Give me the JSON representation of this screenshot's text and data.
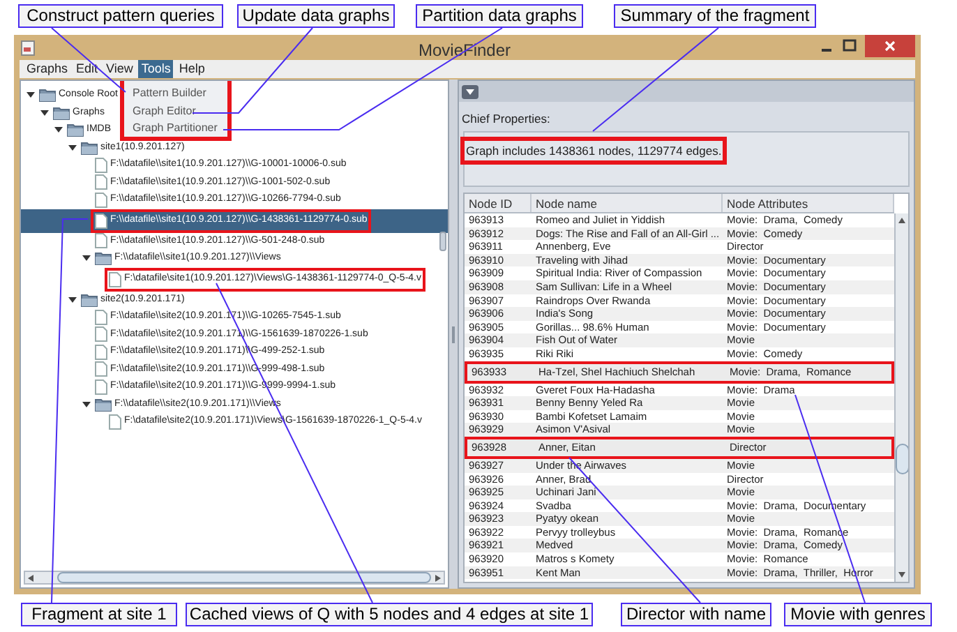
{
  "annotations": {
    "top": [
      "Construct pattern queries",
      "Update data graphs",
      "Partition data graphs",
      "Summary of the fragment"
    ],
    "bottom": [
      "Fragment at site 1",
      "Cached views of Q with 5 nodes and 4 edges at site 1",
      "Director with name",
      "Movie with genres"
    ]
  },
  "window": {
    "title": "MovieFinder"
  },
  "menu_bar": [
    {
      "label": "Graphs",
      "selected": false
    },
    {
      "label": "Edit",
      "selected": false
    },
    {
      "label": "View",
      "selected": false
    },
    {
      "label": "Tools",
      "selected": true
    },
    {
      "label": "Help",
      "selected": false
    }
  ],
  "tools_menu": {
    "highlighted": true,
    "items": [
      "Pattern Builder",
      "Graph Editor",
      "Graph Partitioner"
    ]
  },
  "tree": [
    {
      "label": "Console Root",
      "kind": "folder",
      "expanded": true,
      "selected": false,
      "highlighted": false,
      "children": [
        {
          "label": "Graphs",
          "kind": "folder",
          "expanded": true,
          "selected": false,
          "highlighted": false,
          "children": [
            {
              "label": "IMDB",
              "kind": "folder",
              "expanded": true,
              "selected": false,
              "highlighted": false,
              "children": [
                {
                  "label": "site1(10.9.201.127)",
                  "kind": "folder",
                  "expanded": true,
                  "selected": false,
                  "highlighted": false,
                  "children": [
                    {
                      "label": "F:\\\\datafile\\\\site1(10.9.201.127)\\\\G-10001-10006-0.sub",
                      "kind": "file",
                      "selected": false,
                      "highlighted": false
                    },
                    {
                      "label": "F:\\\\datafile\\\\site1(10.9.201.127)\\\\G-1001-502-0.sub",
                      "kind": "file",
                      "selected": false,
                      "highlighted": false
                    },
                    {
                      "label": "F:\\\\datafile\\\\site1(10.9.201.127)\\\\G-10266-7794-0.sub",
                      "kind": "file",
                      "selected": false,
                      "highlighted": false
                    },
                    {
                      "label": "F:\\\\datafile\\\\site1(10.9.201.127)\\\\G-1438361-1129774-0.sub",
                      "kind": "file",
                      "selected": true,
                      "highlighted": true
                    },
                    {
                      "label": "F:\\\\datafile\\\\site1(10.9.201.127)\\\\G-501-248-0.sub",
                      "kind": "file",
                      "selected": false,
                      "highlighted": false
                    },
                    {
                      "label": "F:\\\\datafile\\\\site1(10.9.201.127)\\\\Views",
                      "kind": "folder",
                      "expanded": true,
                      "selected": false,
                      "highlighted": false,
                      "children": [
                        {
                          "label": "F:\\datafile\\site1(10.9.201.127)\\Views\\G-1438361-1129774-0_Q-5-4.v",
                          "kind": "file",
                          "selected": false,
                          "highlighted": true
                        }
                      ]
                    }
                  ]
                },
                {
                  "label": "site2(10.9.201.171)",
                  "kind": "folder",
                  "expanded": true,
                  "selected": false,
                  "highlighted": false,
                  "children": [
                    {
                      "label": "F:\\\\datafile\\\\site2(10.9.201.171)\\\\G-10265-7545-1.sub",
                      "kind": "file",
                      "selected": false,
                      "highlighted": false
                    },
                    {
                      "label": "F:\\\\datafile\\\\site2(10.9.201.171)\\\\G-1561639-1870226-1.sub",
                      "kind": "file",
                      "selected": false,
                      "highlighted": false
                    },
                    {
                      "label": "F:\\\\datafile\\\\site2(10.9.201.171)\\\\G-499-252-1.sub",
                      "kind": "file",
                      "selected": false,
                      "highlighted": false
                    },
                    {
                      "label": "F:\\\\datafile\\\\site2(10.9.201.171)\\\\G-999-498-1.sub",
                      "kind": "file",
                      "selected": false,
                      "highlighted": false
                    },
                    {
                      "label": "F:\\\\datafile\\\\site2(10.9.201.171)\\\\G-9999-9994-1.sub",
                      "kind": "file",
                      "selected": false,
                      "highlighted": false
                    },
                    {
                      "label": "F:\\\\datafile\\\\site2(10.9.201.171)\\\\Views",
                      "kind": "folder",
                      "expanded": true,
                      "selected": false,
                      "highlighted": false,
                      "children": [
                        {
                          "label": "F:\\datafile\\site2(10.9.201.171)\\Views\\G-1561639-1870226-1_Q-5-4.v",
                          "kind": "file",
                          "selected": false,
                          "highlighted": false
                        }
                      ]
                    }
                  ]
                }
              ]
            }
          ]
        }
      ]
    }
  ],
  "properties": {
    "title": "Chief Properties:",
    "summary": "Graph includes 1438361 nodes, 1129774 edges.",
    "highlighted": true
  },
  "table": {
    "columns": [
      "Node ID",
      "Node name",
      "Node Attributes"
    ],
    "rows": [
      {
        "cells": [
          "963913",
          "Romeo and Juliet in Yiddish",
          "Movie:  Drama,  Comedy"
        ],
        "highlighted": false
      },
      {
        "cells": [
          "963912",
          "Dogs: The Rise and Fall of an All-Girl ...",
          "Movie:  Comedy"
        ],
        "highlighted": false
      },
      {
        "cells": [
          "963911",
          "Annenberg, Eve",
          "Director"
        ],
        "highlighted": false
      },
      {
        "cells": [
          "963910",
          "Traveling with Jihad",
          "Movie:  Documentary"
        ],
        "highlighted": false
      },
      {
        "cells": [
          "963909",
          "Spiritual India: River of Compassion",
          "Movie:  Documentary"
        ],
        "highlighted": false
      },
      {
        "cells": [
          "963908",
          "Sam Sullivan: Life in a Wheel",
          "Movie:  Documentary"
        ],
        "highlighted": false
      },
      {
        "cells": [
          "963907",
          "Raindrops Over Rwanda",
          "Movie:  Documentary"
        ],
        "highlighted": false
      },
      {
        "cells": [
          "963906",
          "India's Song",
          "Movie:  Documentary"
        ],
        "highlighted": false
      },
      {
        "cells": [
          "963905",
          "Gorillas... 98.6% Human",
          "Movie:  Documentary"
        ],
        "highlighted": false
      },
      {
        "cells": [
          "963904",
          "Fish Out of Water",
          "Movie"
        ],
        "highlighted": false
      },
      {
        "cells": [
          "963935",
          "Riki Riki",
          "Movie:  Comedy"
        ],
        "highlighted": false
      },
      {
        "cells": [
          "963933",
          "Ha-Tzel, Shel Hachiuch Shelchah",
          "Movie:  Drama,  Romance"
        ],
        "highlighted": true
      },
      {
        "cells": [
          "963932",
          "Gveret Foux Ha-Hadasha",
          "Movie:  Drama"
        ],
        "highlighted": false
      },
      {
        "cells": [
          "963931",
          "Benny Benny Yeled Ra",
          "Movie"
        ],
        "highlighted": false
      },
      {
        "cells": [
          "963930",
          "Bambi Kofetset Lamaim",
          "Movie"
        ],
        "highlighted": false
      },
      {
        "cells": [
          "963929",
          "Asimon V'Asival",
          "Movie"
        ],
        "highlighted": false
      },
      {
        "cells": [
          "963928",
          "Anner, Eitan",
          "Director"
        ],
        "highlighted": true
      },
      {
        "cells": [
          "963927",
          "Under the Airwaves",
          "Movie"
        ],
        "highlighted": false
      },
      {
        "cells": [
          "963926",
          "Anner, Brad",
          "Director"
        ],
        "highlighted": false
      },
      {
        "cells": [
          "963925",
          "Uchinari Jani",
          "Movie"
        ],
        "highlighted": false
      },
      {
        "cells": [
          "963924",
          "Svadba",
          "Movie:  Drama,  Documentary"
        ],
        "highlighted": false
      },
      {
        "cells": [
          "963923",
          "Pyatyy okean",
          "Movie"
        ],
        "highlighted": false
      },
      {
        "cells": [
          "963922",
          "Pervyy trolleybus",
          "Movie:  Drama,  Romance"
        ],
        "highlighted": false
      },
      {
        "cells": [
          "963921",
          "Medved",
          "Movie:  Drama,  Comedy"
        ],
        "highlighted": false
      },
      {
        "cells": [
          "963920",
          "Matros s Komety",
          "Movie:  Romance"
        ],
        "highlighted": false
      },
      {
        "cells": [
          "963951",
          "Kent Man",
          "Movie:  Drama,  Thriller,  Horror"
        ],
        "highlighted": false
      }
    ]
  }
}
